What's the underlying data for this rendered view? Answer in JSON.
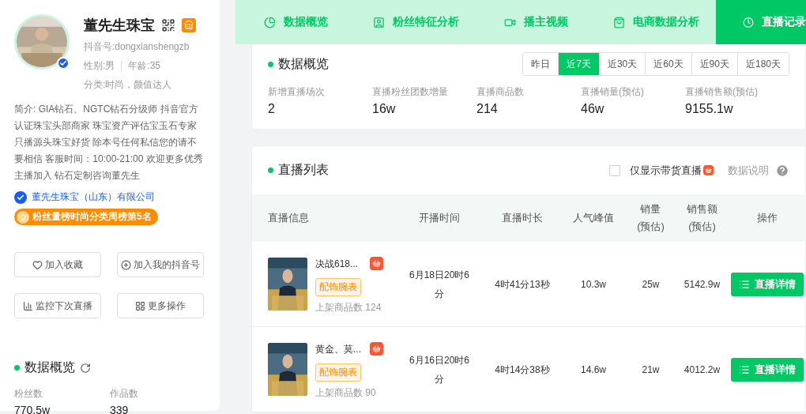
{
  "profile": {
    "name": "董先生珠宝",
    "verified": true,
    "douyin_id": "抖音号:dongxianshengzb",
    "gender": "性别:男",
    "age": "年龄:35",
    "category": "分类:时尚，颜值达人",
    "bio": "简介: GIA钻石、NGTC钻石分级师 抖音官方认证珠宝头部商家 珠宝资产评估宝玉石专家只播源头珠宝好货 除本号任何私信您的请不要相信 客服时间：10:00-21:00 欢迎更多优秀主播加入 钻石定制咨询董先生",
    "company": "董先生珠宝（山东）有限公司",
    "rank_badge": "粉丝量榜时尚分类周榜第5名",
    "actions": [
      {
        "kind": "heart",
        "label": "加入收藏"
      },
      {
        "kind": "plus",
        "label": "加入我的抖音号"
      },
      {
        "kind": "chart",
        "label": "监控下次直播"
      },
      {
        "kind": "grid",
        "label": "更多操作"
      }
    ],
    "overview": {
      "title": "数据概览",
      "stats": [
        {
          "label": "粉丝数",
          "value": "770.5w"
        },
        {
          "label": "作品数",
          "value": "339"
        }
      ]
    }
  },
  "tabs": [
    {
      "kind": "pie",
      "label": "数据概览",
      "selected": false
    },
    {
      "kind": "person",
      "label": "粉丝特征分析",
      "selected": false
    },
    {
      "kind": "video",
      "label": "播主视频",
      "selected": false
    },
    {
      "kind": "bag",
      "label": "电商数据分析",
      "selected": false
    },
    {
      "kind": "clock",
      "label": "直播记录",
      "selected": true
    }
  ],
  "data_overview": {
    "title": "数据概览",
    "ranges": [
      {
        "label": "昨日",
        "selected": false
      },
      {
        "label": "近7天",
        "selected": true
      },
      {
        "label": "近30天",
        "selected": false
      },
      {
        "label": "近60天",
        "selected": false
      },
      {
        "label": "近90天",
        "selected": false
      },
      {
        "label": "近180天",
        "selected": false
      }
    ],
    "stats": [
      {
        "label": "新增直播场次",
        "value": "2"
      },
      {
        "label": "直播粉丝团数增量",
        "value": "16w"
      },
      {
        "label": "直播商品数",
        "value": "214"
      },
      {
        "label": "直播销量(预估)",
        "value": "46w"
      },
      {
        "label": "直播销售额(预估)",
        "value": "9155.1w"
      }
    ]
  },
  "live_list": {
    "title": "直播列表",
    "filter": {
      "label": "仅显示带货直播",
      "checked": false
    },
    "help": "数据说明",
    "columns": [
      "直播信息",
      "开播时间",
      "直播时长",
      "人气峰值",
      "销量\n(预估)",
      "销售额\n(预估)",
      "操作"
    ],
    "rows": [
      {
        "title": "决战618...",
        "tag": "配饰腕表",
        "products": "上架商品数 124",
        "start": "6月18日20时6分",
        "duration": "4时41分13秒",
        "peak": "10.3w",
        "sales": "25w",
        "revenue": "5142.9w",
        "action": "直播详情"
      },
      {
        "title": "黄金、莫...",
        "tag": "配饰腕表",
        "products": "上架商品数 90",
        "start": "6月16日20时6分",
        "duration": "4时14分38秒",
        "peak": "14.6w",
        "sales": "21w",
        "revenue": "4012.2w",
        "action": "直播详情"
      }
    ]
  }
}
